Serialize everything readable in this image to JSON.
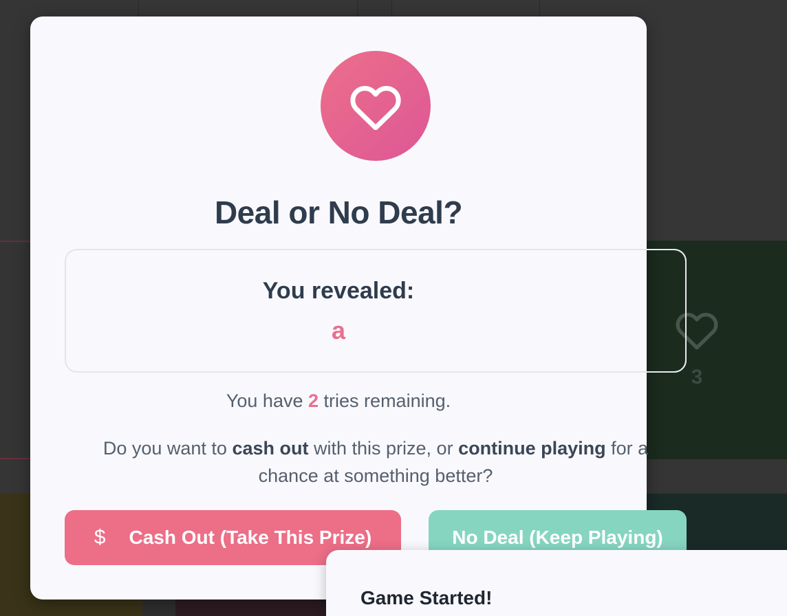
{
  "background": {
    "card_number": "3",
    "card_icon": "heart-icon"
  },
  "modal": {
    "icon": "heart-icon",
    "title": "Deal or No Deal?",
    "reveal_label": "You revealed:",
    "reveal_prize": "a",
    "tries_prefix": "You have",
    "tries_count": "2",
    "tries_suffix": "tries remaining.",
    "question_part1": "Do you want to",
    "question_bold1": "cash out",
    "question_part2": "with this prize, or",
    "question_bold2": "continue playing",
    "question_part3": "for a chance at something better?",
    "cash_out_icon": "dollar-icon",
    "cash_out_label": "Cash Out (Take This Prize)",
    "no_deal_label": "No Deal (Keep Playing)"
  },
  "toast": {
    "message": "Game Started!"
  },
  "colors": {
    "accent_pink": "#ec6e87",
    "accent_teal": "#86d5c1",
    "title_text": "#2f3c4d"
  }
}
